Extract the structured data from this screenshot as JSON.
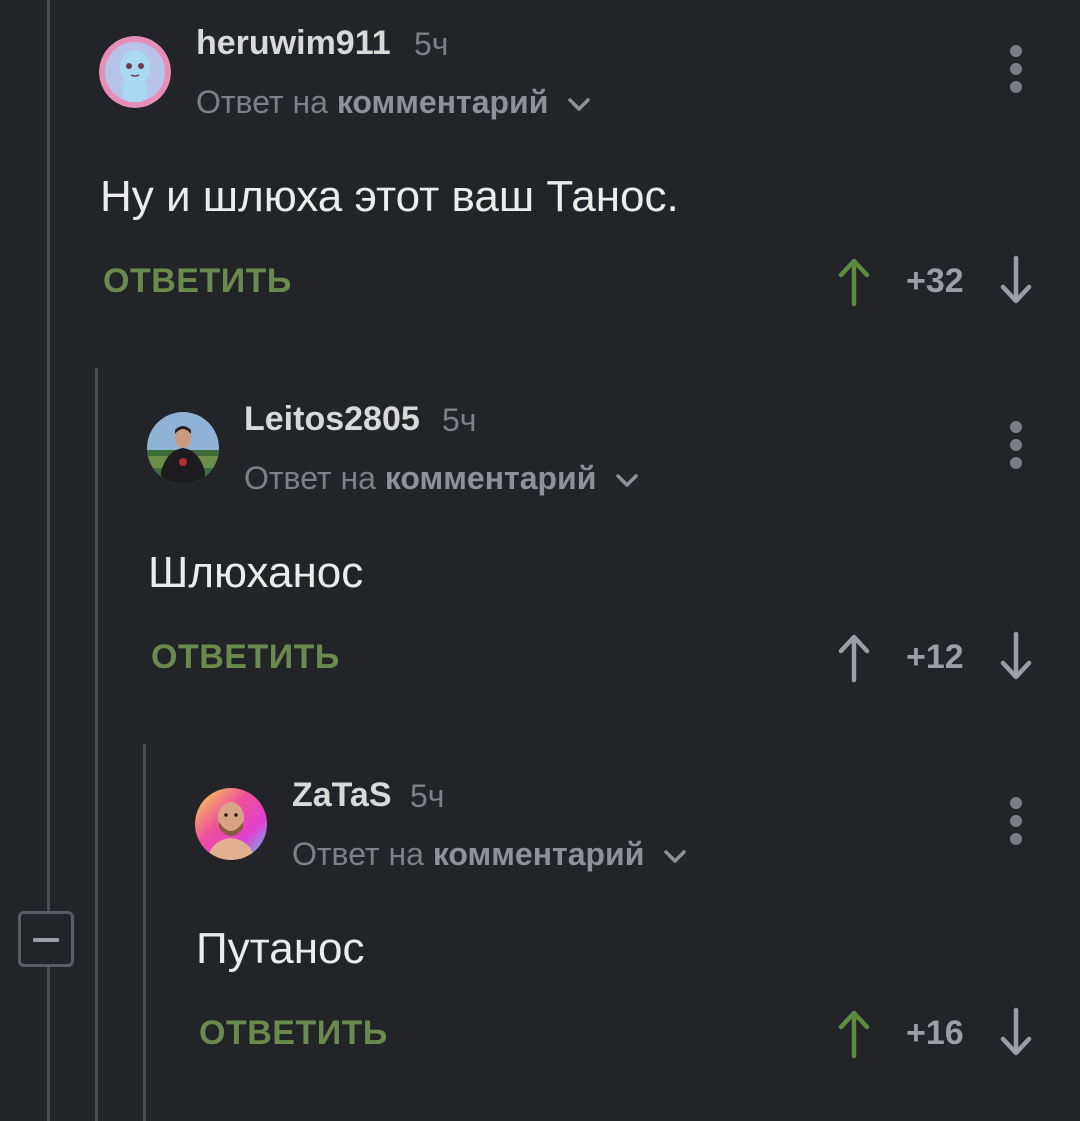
{
  "colors": {
    "background": "#222427",
    "accent_green": "#6a8b4d",
    "upvote_active": "#5f8b3f",
    "icon_gray": "#7a7d81"
  },
  "comments": [
    {
      "username": "heruwim911",
      "time": "5ч",
      "reply_prefix": "Ответ на",
      "reply_target": "комментарий",
      "text": "Ну и шлюха этот ваш Танос.",
      "reply_label": "ОТВЕТИТЬ",
      "score": "+32",
      "upvoted": true,
      "avatar_icon": "alien-avatar-icon"
    },
    {
      "username": "Leitos2805",
      "time": "5ч",
      "reply_prefix": "Ответ на",
      "reply_target": "комментарий",
      "text": "Шлюханос",
      "reply_label": "ОТВЕТИТЬ",
      "score": "+12",
      "upvoted": false,
      "avatar_icon": "person-photo-avatar-icon"
    },
    {
      "username": "ZaTaS",
      "time": "5ч",
      "reply_prefix": "Ответ на",
      "reply_target": "комментарий",
      "text": "Путанос",
      "reply_label": "ОТВЕТИТЬ",
      "score": "+16",
      "upvoted": true,
      "avatar_icon": "bald-man-avatar-icon"
    }
  ]
}
